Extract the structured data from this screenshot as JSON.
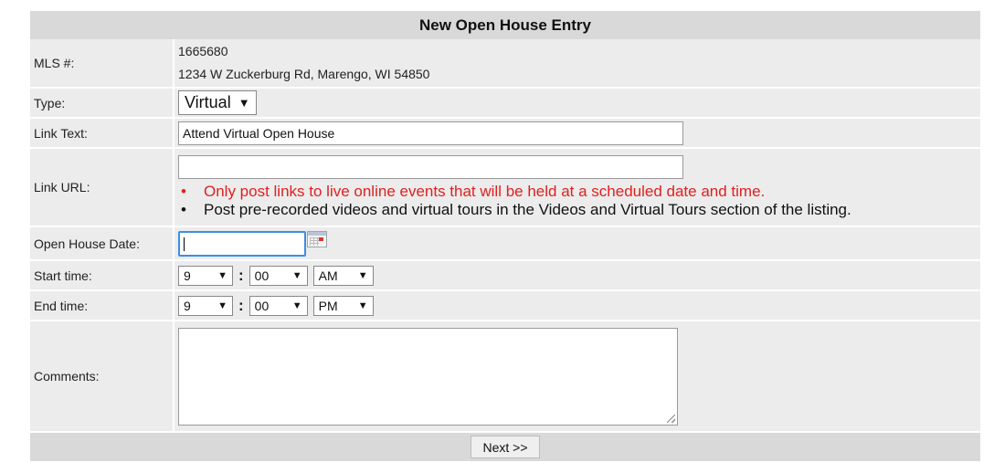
{
  "form": {
    "title": "New Open House Entry",
    "mls": {
      "label": "MLS #:",
      "number": "1665680",
      "address": "1234 W Zuckerburg Rd, Marengo, WI 54850"
    },
    "type": {
      "label": "Type:",
      "selected": "Virtual"
    },
    "link_text": {
      "label": "Link Text:",
      "value": "Attend Virtual Open House"
    },
    "link_url": {
      "label": "Link URL:",
      "value": "",
      "notes": [
        "Only post links to live online events that will be held at a scheduled date and time.",
        "Post pre-recorded videos and virtual tours in the Videos and Virtual Tours section of the listing."
      ]
    },
    "open_house_date": {
      "label": "Open House Date:",
      "value": "",
      "calendar_icon": "calendar-icon"
    },
    "start_time": {
      "label": "Start time:",
      "hour": "9",
      "minute": "00",
      "ampm": "AM"
    },
    "end_time": {
      "label": "End time:",
      "hour": "9",
      "minute": "00",
      "ampm": "PM"
    },
    "comments": {
      "label": "Comments:",
      "value": ""
    },
    "next_button": "Next >>"
  },
  "colors": {
    "header_bg": "#d9d9d9",
    "row_bg": "#ececec",
    "warning_text": "#e02020",
    "focus_border": "#3b8fe0"
  }
}
